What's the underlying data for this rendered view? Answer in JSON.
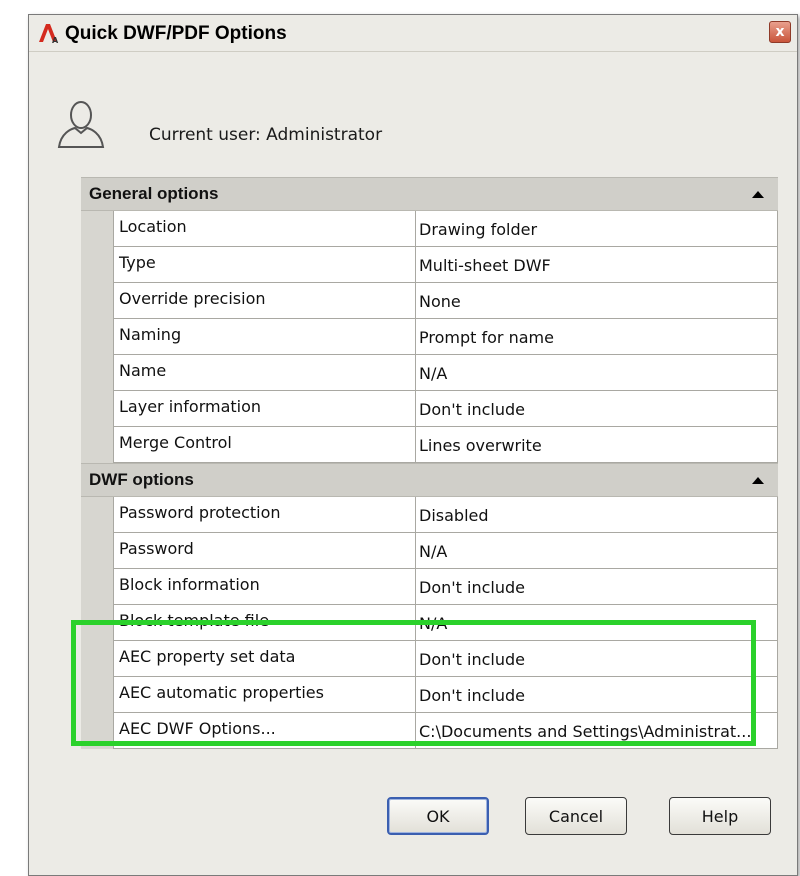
{
  "window": {
    "title": "Quick DWF/PDF Options",
    "close_label": "x"
  },
  "user": {
    "label": "Current user: Administrator"
  },
  "sections": {
    "general": {
      "title": "General options",
      "rows": [
        {
          "name": "Location",
          "value": "Drawing folder"
        },
        {
          "name": "Type",
          "value": "Multi-sheet DWF"
        },
        {
          "name": "Override precision",
          "value": "None"
        },
        {
          "name": "Naming",
          "value": "Prompt for name"
        },
        {
          "name": "Name",
          "value": "N/A"
        },
        {
          "name": "Layer information",
          "value": "Don't include"
        },
        {
          "name": "Merge Control",
          "value": "Lines overwrite"
        }
      ]
    },
    "dwf": {
      "title": "DWF options",
      "rows": [
        {
          "name": "Password protection",
          "value": "Disabled"
        },
        {
          "name": "Password",
          "value": "N/A"
        },
        {
          "name": "Block information",
          "value": "Don't include"
        },
        {
          "name": "Block template file",
          "value": "N/A"
        },
        {
          "name": "AEC property set data",
          "value": "Don't include"
        },
        {
          "name": "AEC automatic properties",
          "value": "Don't include"
        },
        {
          "name": "AEC DWF Options...",
          "value": "C:\\Documents and Settings\\Administrat..."
        }
      ]
    }
  },
  "buttons": {
    "ok": "OK",
    "cancel": "Cancel",
    "help": "Help"
  },
  "colors": {
    "highlight": "#2bd12b",
    "dialog_bg": "#ecebe6",
    "close_button": "#c9553b"
  },
  "icons": {
    "app": "autocad-logo-icon",
    "user": "user-silhouette-icon",
    "close": "close-icon",
    "collapse": "collapse-up-arrow-icon"
  }
}
